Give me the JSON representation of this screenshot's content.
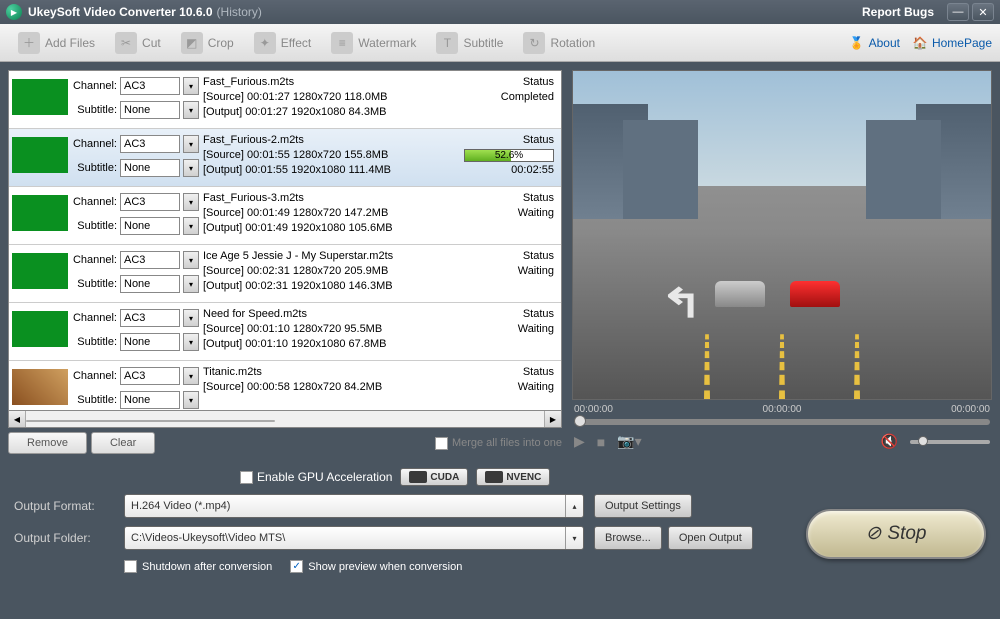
{
  "title": {
    "main": "UkeySoft Video Converter 10.6.0",
    "sub": "(History)",
    "report": "Report Bugs"
  },
  "toolbar": {
    "addFiles": "Add Files",
    "cut": "Cut",
    "crop": "Crop",
    "effect": "Effect",
    "watermark": "Watermark",
    "subtitle": "Subtitle",
    "rotation": "Rotation",
    "about": "About",
    "homepage": "HomePage"
  },
  "labels": {
    "channel": "Channel:",
    "subtitle": "Subtitle:",
    "status": "Status"
  },
  "files": [
    {
      "channel": "AC3",
      "subtitle": "None",
      "name": "Fast_Furious.m2ts",
      "source": "[Source] 00:01:27 1280x720 118.0MB",
      "output": "[Output] 00:01:27 1920x1080 84.3MB",
      "status": "Completed",
      "progress": null,
      "eta": "",
      "thumb": "green"
    },
    {
      "channel": "AC3",
      "subtitle": "None",
      "name": "Fast_Furious-2.m2ts",
      "source": "[Source] 00:01:55 1280x720 155.8MB",
      "output": "[Output] 00:01:55 1920x1080 111.4MB",
      "status": "",
      "progress": 52.6,
      "eta": "00:02:55",
      "thumb": "green",
      "selected": true
    },
    {
      "channel": "AC3",
      "subtitle": "None",
      "name": "Fast_Furious-3.m2ts",
      "source": "[Source] 00:01:49 1280x720 147.2MB",
      "output": "[Output] 00:01:49 1920x1080 105.6MB",
      "status": "Waiting",
      "progress": null,
      "eta": "",
      "thumb": "green"
    },
    {
      "channel": "AC3",
      "subtitle": "None",
      "name": "Ice Age 5 Jessie J - My Superstar.m2ts",
      "source": "[Source] 00:02:31 1280x720 205.9MB",
      "output": "[Output] 00:02:31 1920x1080 146.3MB",
      "status": "Waiting",
      "progress": null,
      "eta": "",
      "thumb": "green"
    },
    {
      "channel": "AC3",
      "subtitle": "None",
      "name": "Need for Speed.m2ts",
      "source": "[Source] 00:01:10 1280x720 95.5MB",
      "output": "[Output] 00:01:10 1920x1080 67.8MB",
      "status": "Waiting",
      "progress": null,
      "eta": "",
      "thumb": "green"
    },
    {
      "channel": "AC3",
      "subtitle": "None",
      "name": "Titanic.m2ts",
      "source": "[Source] 00:00:58 1280x720 84.2MB",
      "output": "",
      "status": "Waiting",
      "progress": null,
      "eta": "",
      "thumb": "movie"
    }
  ],
  "listButtons": {
    "remove": "Remove",
    "clear": "Clear",
    "merge": "Merge all files into one"
  },
  "preview": {
    "time1": "00:00:00",
    "time2": "00:00:00",
    "time3": "00:00:00"
  },
  "gpu": {
    "enable": "Enable GPU Acceleration",
    "cuda": "CUDA",
    "nvenc": "NVENC"
  },
  "output": {
    "formatLabel": "Output Format:",
    "formatValue": "H.264 Video (*.mp4)",
    "folderLabel": "Output Folder:",
    "folderValue": "C:\\Videos-Ukeysoft\\Video MTS\\",
    "settings": "Output Settings",
    "browse": "Browse...",
    "open": "Open Output",
    "shutdown": "Shutdown after conversion",
    "showPreview": "Show preview when conversion",
    "stop": "Stop"
  }
}
